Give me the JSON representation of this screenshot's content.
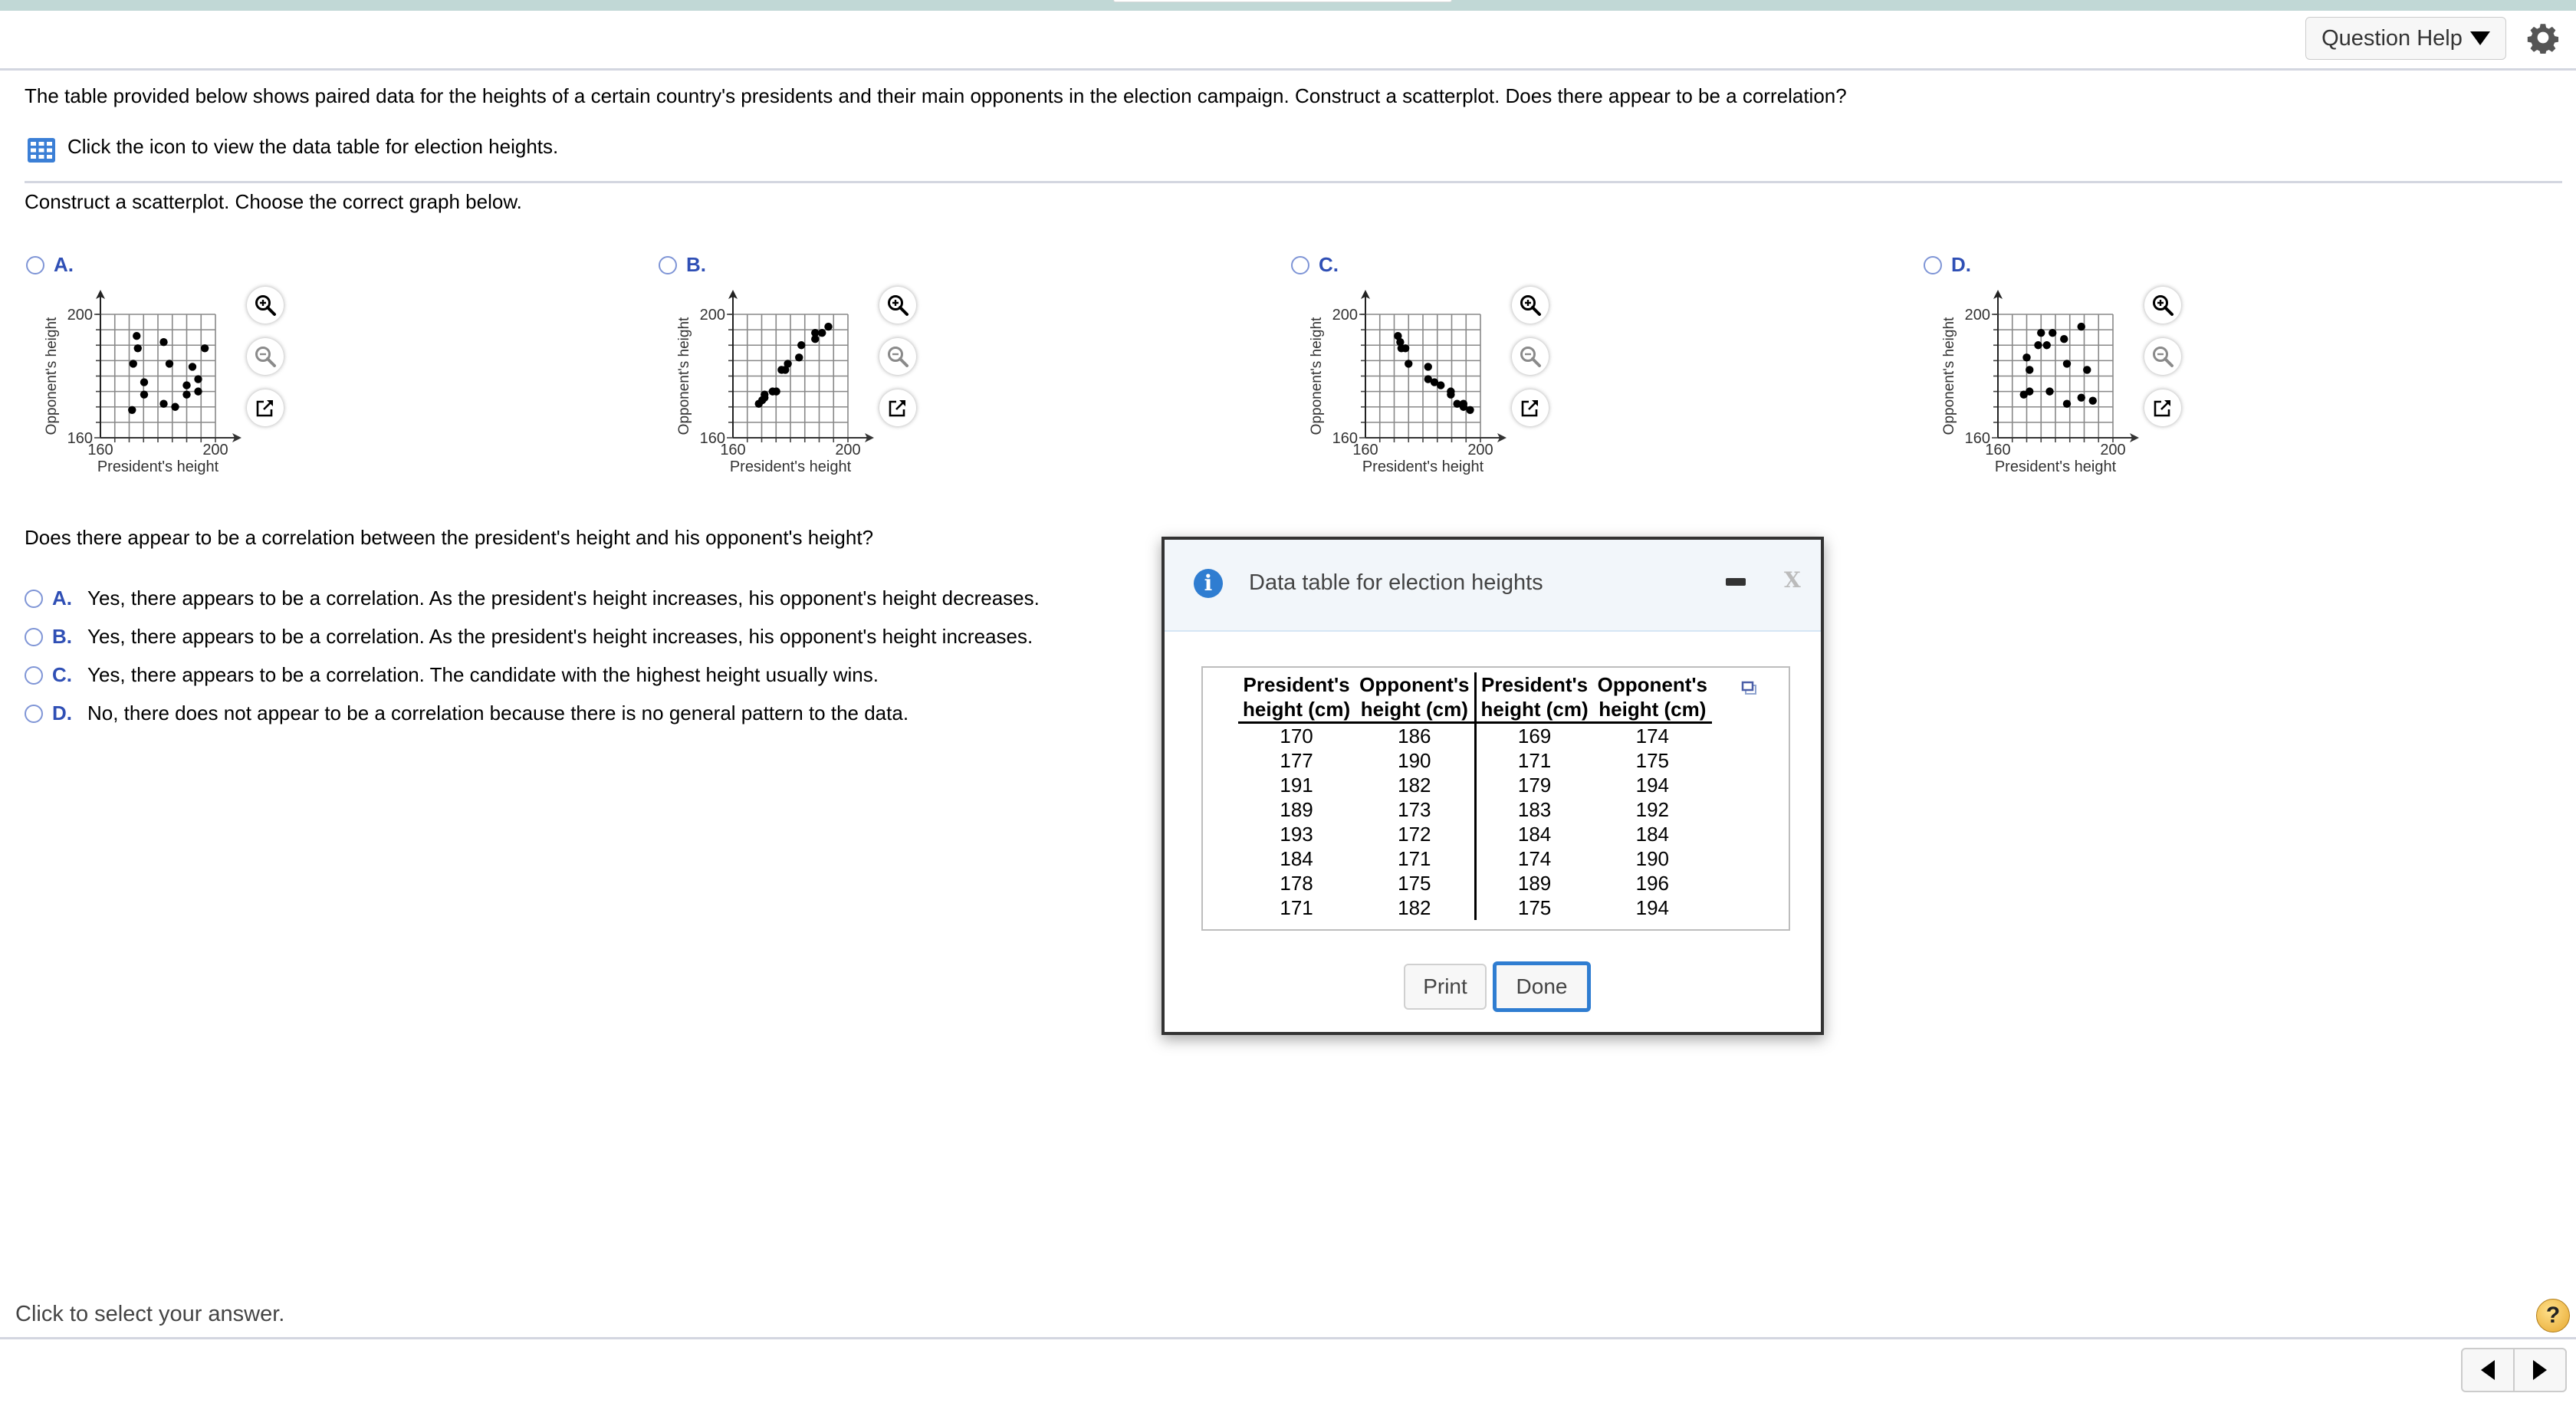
{
  "header": {
    "question_help_label": "Question Help",
    "settings_icon": "gear-icon"
  },
  "question": {
    "prompt": "The table provided below shows paired data for the heights of a certain country's presidents and their main opponents in the election campaign. Construct a scatterplot. Does there appear to be a correlation?",
    "table_link_text": "Click the icon to view the data table for election heights.",
    "table_icon": "table-icon",
    "part1_prompt": "Construct a scatterplot. Choose the correct graph below.",
    "part2_prompt": "Does there appear to be a correlation between the president's height and his opponent's height?"
  },
  "graph_options": [
    {
      "label": "A."
    },
    {
      "label": "B."
    },
    {
      "label": "C."
    },
    {
      "label": "D."
    }
  ],
  "chart_data": [
    {
      "type": "scatter",
      "option": "A",
      "xlabel": "President's height",
      "ylabel": "Opponent's height",
      "xlim": [
        160,
        200
      ],
      "ylim": [
        160,
        200
      ],
      "xticks": [
        "160",
        "200"
      ],
      "yticks": [
        "160",
        "200"
      ],
      "grid": true,
      "grid_step": 5,
      "points": [
        [
          172.6,
          193
        ],
        [
          173,
          189
        ],
        [
          171.4,
          184
        ],
        [
          175.2,
          178
        ],
        [
          175.2,
          174
        ],
        [
          171,
          169
        ],
        [
          182,
          191
        ],
        [
          184,
          184
        ],
        [
          182,
          171
        ],
        [
          186,
          170
        ],
        [
          196.3,
          189
        ],
        [
          192,
          183
        ],
        [
          194,
          179
        ],
        [
          190,
          177
        ],
        [
          190,
          174
        ],
        [
          194,
          175
        ]
      ]
    },
    {
      "type": "scatter",
      "option": "B",
      "xlabel": "President's height",
      "ylabel": "Opponent's height",
      "xlim": [
        160,
        200
      ],
      "ylim": [
        160,
        200
      ],
      "xticks": [
        "160",
        "200"
      ],
      "yticks": [
        "160",
        "200"
      ],
      "grid": true,
      "grid_step": 5,
      "points": [
        [
          169,
          171
        ],
        [
          170.2,
          172.2
        ],
        [
          171,
          173
        ],
        [
          171,
          174
        ],
        [
          173.8,
          175
        ],
        [
          175.1,
          175
        ],
        [
          176.9,
          182
        ],
        [
          178.2,
          182
        ],
        [
          179.1,
          184
        ],
        [
          183,
          186
        ],
        [
          183.8,
          190
        ],
        [
          188.6,
          192
        ],
        [
          188.6,
          194
        ],
        [
          191,
          194
        ],
        [
          193.2,
          196
        ]
      ]
    },
    {
      "type": "scatter",
      "option": "C",
      "xlabel": "President's height",
      "ylabel": "Opponent's height",
      "xlim": [
        160,
        200
      ],
      "ylim": [
        160,
        200
      ],
      "xticks": [
        "160",
        "200"
      ],
      "yticks": [
        "160",
        "200"
      ],
      "grid": true,
      "grid_step": 5,
      "points": [
        [
          171.3,
          193
        ],
        [
          172.1,
          191
        ],
        [
          172.5,
          189
        ],
        [
          173.9,
          189
        ],
        [
          175,
          184
        ],
        [
          181.8,
          183
        ],
        [
          181.8,
          179
        ],
        [
          184,
          178
        ],
        [
          186.2,
          177
        ],
        [
          189.7,
          175
        ],
        [
          189.7,
          174
        ],
        [
          191.9,
          171
        ],
        [
          194.1,
          171
        ],
        [
          194.1,
          170
        ],
        [
          196.4,
          169
        ]
      ]
    },
    {
      "type": "scatter",
      "option": "D",
      "xlabel": "President's height",
      "ylabel": "Opponent's height",
      "xlim": [
        160,
        200
      ],
      "ylim": [
        160,
        200
      ],
      "xticks": [
        "160",
        "200"
      ],
      "yticks": [
        "160",
        "200"
      ],
      "grid": true,
      "grid_step": 5,
      "points": [
        [
          170,
          186
        ],
        [
          177,
          190
        ],
        [
          191,
          182
        ],
        [
          189,
          173
        ],
        [
          193,
          172
        ],
        [
          184,
          171
        ],
        [
          178,
          175
        ],
        [
          171,
          182
        ],
        [
          169,
          174
        ],
        [
          171,
          175
        ],
        [
          179,
          194
        ],
        [
          183,
          192
        ],
        [
          184,
          184
        ],
        [
          174,
          190
        ],
        [
          189,
          196
        ],
        [
          175,
          194
        ]
      ]
    }
  ],
  "answers": [
    {
      "letter": "A.",
      "text": "Yes, there appears to be a correlation. As the president's height increases, his opponent's height decreases."
    },
    {
      "letter": "B.",
      "text": "Yes, there appears to be a correlation. As the president's height increases, his opponent's height increases."
    },
    {
      "letter": "C.",
      "text": "Yes, there appears to be a correlation. The candidate with the highest height usually wins."
    },
    {
      "letter": "D.",
      "text": "No, there does not appear to be a correlation because there is no general pattern to the data."
    }
  ],
  "dialog": {
    "title": "Data table for election heights",
    "headers": [
      [
        "President's",
        "height (cm)"
      ],
      [
        "Opponent's",
        "height (cm)"
      ],
      [
        "President's",
        "height (cm)"
      ],
      [
        "Opponent's",
        "height (cm)"
      ]
    ],
    "rows": [
      [
        "170",
        "186",
        "169",
        "174"
      ],
      [
        "177",
        "190",
        "171",
        "175"
      ],
      [
        "191",
        "182",
        "179",
        "194"
      ],
      [
        "189",
        "173",
        "183",
        "192"
      ],
      [
        "193",
        "172",
        "184",
        "184"
      ],
      [
        "184",
        "171",
        "174",
        "190"
      ],
      [
        "178",
        "175",
        "189",
        "196"
      ],
      [
        "171",
        "182",
        "175",
        "194"
      ]
    ],
    "print_label": "Print",
    "done_label": "Done"
  },
  "footer": {
    "status_text": "Click to select your answer.",
    "help_label": "?"
  },
  "colors": {
    "accent": "#2f7dd1",
    "option_letter": "#2f4fb5",
    "topbar": "#c1d8d6"
  }
}
